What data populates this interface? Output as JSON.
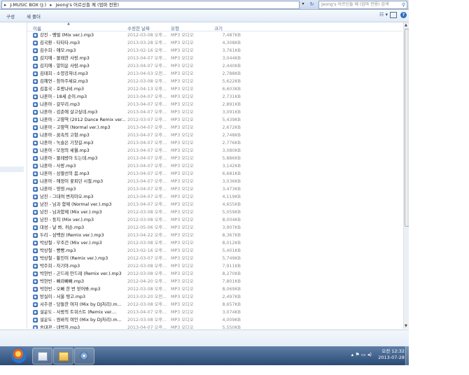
{
  "address": {
    "path": [
      "J-MUSIC BOX (J:)",
      "Jeong's 어르신들 께 (엄마 전용)"
    ],
    "search_placeholder": "Jeong's 어르신들 께 (엄마 전용) 검색"
  },
  "toolbar": {
    "organize": "구성",
    "new_folder": "새 폴더"
  },
  "columns": {
    "name": "이름",
    "date": "수정한 날짜",
    "type": "유형",
    "size": "크기"
  },
  "files": [
    {
      "name": "강진 - 땡벌 (Mix ver.).mp3",
      "date": "2012-03-08 오후...",
      "type": "MP3 오디오",
      "size": "7,487KB"
    },
    {
      "name": "김국환 - 타타타.mp3",
      "date": "2013-03-28 오후...",
      "type": "MP3 오디오",
      "size": "4,308KB"
    },
    {
      "name": "김수희 - 애모.mp3",
      "date": "2013-02-16 오후...",
      "type": "MP3 오디오",
      "size": "3,761KB"
    },
    {
      "name": "김지애 - 몰래한 사랑.mp3",
      "date": "2013-04-07 오후...",
      "type": "MP3 오디오",
      "size": "3,044KB"
    },
    {
      "name": "김지애 - 얄미운 사람.mp3",
      "date": "2013-04-07 오후...",
      "type": "MP3 오디오",
      "size": "2,440KB"
    },
    {
      "name": "김태희 - 소양강처녀.mp3",
      "date": "2013-04-03 오전...",
      "type": "MP3 오디오",
      "size": "2,788KB"
    },
    {
      "name": "김혜연 - 참아주세요.mp3",
      "date": "2012-03-08 오후...",
      "type": "MP3 오디오",
      "size": "5,622KB"
    },
    {
      "name": "김흥국 - 호랑나비.mp3",
      "date": "2012-04-13 오후...",
      "type": "MP3 오디오",
      "size": "6,603KB"
    },
    {
      "name": "나훈아 - 18세 순이.mp3",
      "date": "2013-04-07 오후...",
      "type": "MP3 오디오",
      "size": "2,731KB"
    },
    {
      "name": "나훈아 - 갈무리.mp3",
      "date": "2013-04-07 오후...",
      "type": "MP3 오디오",
      "size": "2,891KB"
    },
    {
      "name": "나훈아 - 감춘에 살고싶네.mp3",
      "date": "2013-04-07 오후...",
      "type": "MP3 오디오",
      "size": "3,091KB"
    },
    {
      "name": "나훈아 - 고향역 (2012 Dance Remix ver...",
      "date": "2012-03-07 오후...",
      "type": "MP3 오디오",
      "size": "5,439KB"
    },
    {
      "name": "나훈아 - 고향역 (Normal ver.).mp3",
      "date": "2013-04-07 오후...",
      "type": "MP3 오디오",
      "size": "2,672KB"
    },
    {
      "name": "나훈아 - 꿈속의 고향.mp3",
      "date": "2013-04-07 오후...",
      "type": "MP3 오디오",
      "size": "2,748KB"
    },
    {
      "name": "나훈아 - 녹슬은 기찻길.mp3",
      "date": "2013-04-07 오후...",
      "type": "MP3 오디오",
      "size": "2,776KB"
    },
    {
      "name": "나훈아 - 모정의 세월.mp3",
      "date": "2013-04-07 오후...",
      "type": "MP3 오디오",
      "size": "3,080KB"
    },
    {
      "name": "나훈아 - 물레방아 도는데.mp3",
      "date": "2013-04-07 오후...",
      "type": "MP3 오디오",
      "size": "5,886KB"
    },
    {
      "name": "나훈아 - 사랑.mp3",
      "date": "2013-04-07 오후...",
      "type": "MP3 오디오",
      "size": "3,142KB"
    },
    {
      "name": "나훈아 - 삼팔선의 봄.mp3",
      "date": "2013-04-07 오후...",
      "type": "MP3 오디오",
      "size": "6,681KB"
    },
    {
      "name": "나훈아 - 애정이 꽃피던 시절.mp3",
      "date": "2013-04-07 오후...",
      "type": "MP3 오디오",
      "size": "3,036KB"
    },
    {
      "name": "나훈아 - 영영.mp3",
      "date": "2013-04-07 오후...",
      "type": "MP3 오디오",
      "size": "3,473KB"
    },
    {
      "name": "남진 - 그대여 변치마오.mp3",
      "date": "2013-04-07 오후...",
      "type": "MP3 오디오",
      "size": "4,119KB"
    },
    {
      "name": "남진 - 님과 함께 (Normal ver.).mp3",
      "date": "2013-04-07 오후...",
      "type": "MP3 오디오",
      "size": "4,655KB"
    },
    {
      "name": "남진 - 님과함께 (Mix ver.).mp3",
      "date": "2012-03-08 오후...",
      "type": "MP3 오디오",
      "size": "5,059KB"
    },
    {
      "name": "남진 - 둥지 (Mix ver.).mp3",
      "date": "2012-03-08 오후...",
      "type": "MP3 오디오",
      "size": "8,004KB"
    },
    {
      "name": "대성 - 날 봐, 귀순.mp3",
      "date": "2012-05-06 오후...",
      "type": "MP3 오디오",
      "size": "3,907KB"
    },
    {
      "name": "두리 - 삼백원 (Remix ver.).mp3",
      "date": "2013-04-22 오후...",
      "type": "MP3 오디오",
      "size": "8,367KB"
    },
    {
      "name": "박상철 - 무조건 (Mix ver.).mp3",
      "date": "2012-03-08 오후...",
      "type": "MP3 오디오",
      "size": "8,012KB"
    },
    {
      "name": "박상철 - 빵빵.mp3",
      "date": "2013-02-16 오후...",
      "type": "MP3 오디오",
      "size": "5,401KB"
    },
    {
      "name": "박상철 - 황진이 (Remix ver.).mp3",
      "date": "2012-03-07 오후...",
      "type": "MP3 오디오",
      "size": "5,749KB"
    },
    {
      "name": "박주희 - 자기야.mp3",
      "date": "2012-03-08 오후...",
      "type": "MP3 오디오",
      "size": "7,911KB"
    },
    {
      "name": "박현빈 - 곤드레 만드레 (Remix ver.).mp3",
      "date": "2012-03-08 오후...",
      "type": "MP3 오디오",
      "size": "8,270KB"
    },
    {
      "name": "박현빈 - 빠라빠빠.mp3",
      "date": "2012-04-20 오후...",
      "type": "MP3 오디오",
      "size": "7,801KB"
    },
    {
      "name": "박현빈 - 오빠 한 번 믿어봐.mp3",
      "date": "2012-03-08 오후...",
      "type": "MP3 오디오",
      "size": "8,069KB"
    },
    {
      "name": "방실이 - 서울 탱고.mp3",
      "date": "2013-03-20 오전...",
      "type": "MP3 오디오",
      "size": "2,497KB"
    },
    {
      "name": "서주경 - 당돌한 여자 (Mix by DJ처리).m...",
      "date": "2012-03-08 오후...",
      "type": "MP3 오디오",
      "size": "8,657KB"
    },
    {
      "name": "설운도 - 사랑의 트위스트 (Remix ver....",
      "date": "2013-04-07 오후...",
      "type": "MP3 오디오",
      "size": "3,074KB"
    },
    {
      "name": "설운도 - 쌈바의 여인 (Mix by DJ처리).m...",
      "date": "2012-03-08 오후...",
      "type": "MP3 오디오",
      "size": "4,009KB"
    },
    {
      "name": "송대관 - 네박자.mp3",
      "date": "2013-04-07 오후...",
      "type": "MP3 오디오",
      "size": "5,550KB"
    }
  ],
  "tray": {
    "time": "오전 12:32",
    "date": "2013-07-28"
  }
}
